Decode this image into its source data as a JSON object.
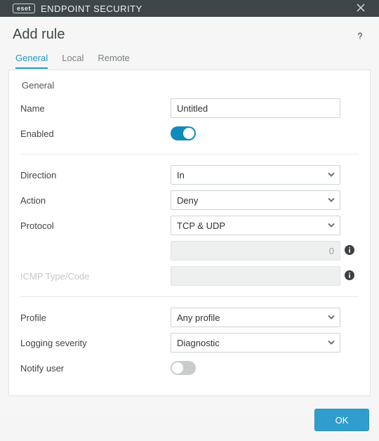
{
  "window": {
    "brand_badge": "eset",
    "brand_text": "ENDPOINT SECURITY",
    "title": "Add rule"
  },
  "tabs": [
    {
      "id": "general",
      "label": "General",
      "active": true
    },
    {
      "id": "local",
      "label": "Local",
      "active": false
    },
    {
      "id": "remote",
      "label": "Remote",
      "active": false
    }
  ],
  "section_label": "General",
  "fields": {
    "name": {
      "label": "Name",
      "value": "Untitled"
    },
    "enabled": {
      "label": "Enabled",
      "value": true
    },
    "direction": {
      "label": "Direction",
      "value": "In"
    },
    "action": {
      "label": "Action",
      "value": "Deny"
    },
    "protocol": {
      "label": "Protocol",
      "value": "TCP & UDP"
    },
    "protocol_number": {
      "label": "",
      "value": "0",
      "disabled": true
    },
    "icmp": {
      "label": "ICMP Type/Code",
      "value": "",
      "disabled": true
    },
    "profile": {
      "label": "Profile",
      "value": "Any profile"
    },
    "severity": {
      "label": "Logging severity",
      "value": "Diagnostic"
    },
    "notify": {
      "label": "Notify user",
      "value": false
    }
  },
  "footer": {
    "ok": "OK"
  },
  "direction_options": [
    "In"
  ],
  "action_options": [
    "Deny"
  ],
  "protocol_options": [
    "TCP & UDP"
  ],
  "profile_options": [
    "Any profile"
  ],
  "severity_options": [
    "Diagnostic"
  ]
}
